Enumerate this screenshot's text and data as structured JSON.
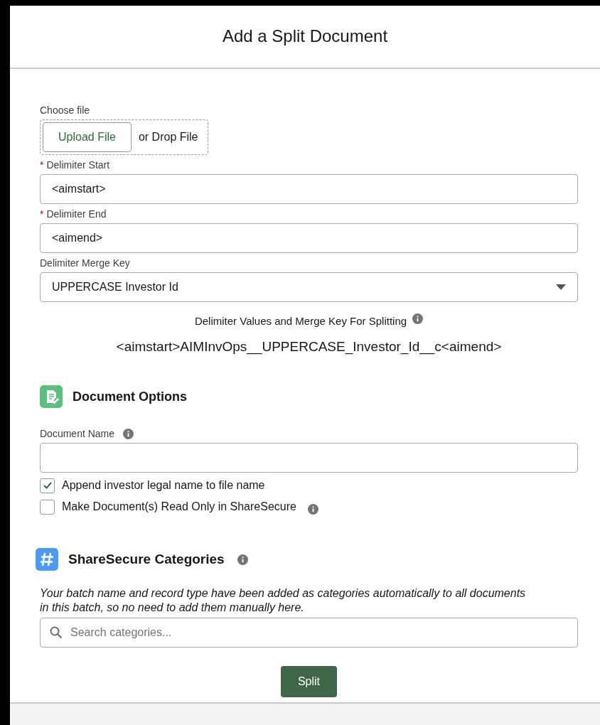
{
  "modal": {
    "title": "Add a Split Document"
  },
  "file_upload": {
    "label": "Choose file",
    "button": "Upload File",
    "drop_text": "or Drop File"
  },
  "fields": [
    {
      "kind": "input",
      "required_mark": "*",
      "label": "Delimiter Start",
      "value": "<aimstart>"
    },
    {
      "kind": "input",
      "required_mark": "*",
      "label": "Delimiter End",
      "value": "<aimend>"
    },
    {
      "kind": "select",
      "label": "Delimiter Merge Key",
      "value": "UPPERCASE Investor Id"
    }
  ],
  "preview": {
    "label": "Delimiter Values and Merge Key For Splitting",
    "value": "<aimstart>AIMInvOps__UPPERCASE_Investor_Id__c<aimend>"
  },
  "document_options": {
    "title": "Document Options",
    "name_field": {
      "label": "Document Name",
      "info": true
    },
    "checkboxes": [
      {
        "label": "Append investor legal name to file name",
        "checked": true,
        "info": false
      },
      {
        "label": "Make Document(s) Read Only in ShareSecure",
        "checked": false,
        "info": true
      }
    ]
  },
  "categories": {
    "title": "ShareSecure Categories",
    "info": true,
    "note": "Your batch name and record type have been added as categories automatically to all documents in this batch, so no need to add them manually here.",
    "search": {
      "placeholder": "Search categories..."
    }
  },
  "actions": {
    "primary": "Split"
  }
}
